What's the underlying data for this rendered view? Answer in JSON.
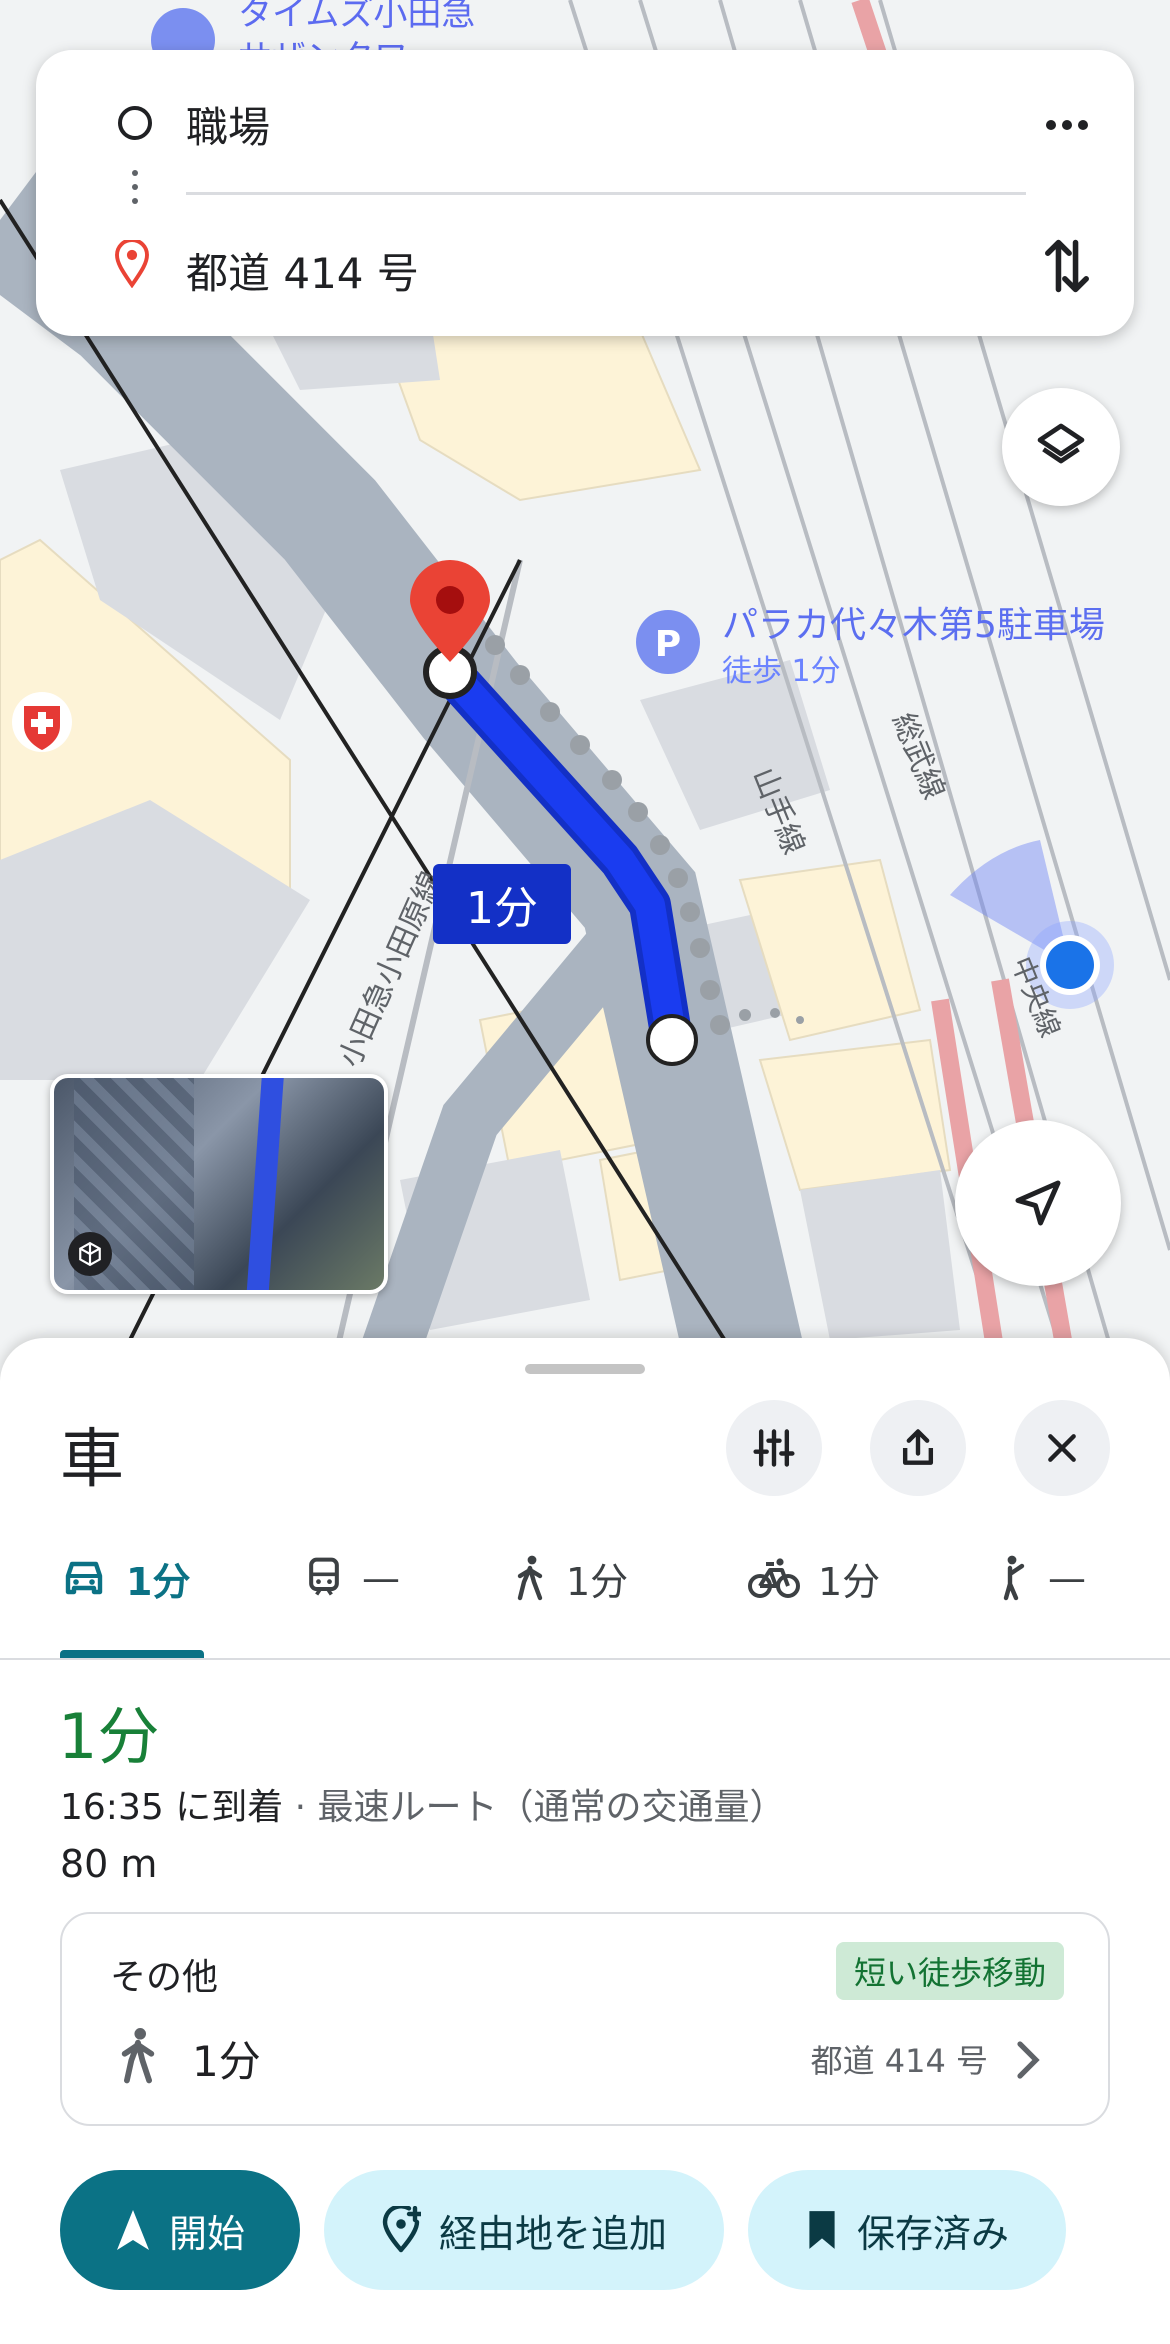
{
  "map": {
    "labels": {
      "top_poi": "タイムズ小田急",
      "top_poi2": "サザンタワー",
      "parking_name": "パラカ代々木第5駐車場",
      "parking_walk": "徒歩 1分",
      "line_yamanote": "山手線",
      "line_sobu": "総武線",
      "line_odakyu": "小田急小田原線",
      "line_chuo": "中央線",
      "route_badge": "1分"
    }
  },
  "route_card": {
    "origin": "職場",
    "destination": "都道 414 号"
  },
  "sheet": {
    "mode_title": "車",
    "tabs": [
      {
        "label": "1分",
        "icon": "car-icon",
        "active": true
      },
      {
        "label": "—",
        "icon": "train-icon",
        "active": false
      },
      {
        "label": "1分",
        "icon": "walk-icon",
        "active": false
      },
      {
        "label": "1分",
        "icon": "bicycle-icon",
        "active": false
      },
      {
        "label": "—",
        "icon": "ride-icon",
        "active": false
      }
    ],
    "duration": "1分",
    "arrival_time": "16:35 に到着",
    "route_desc": " · 最速ルート（通常の交通量）",
    "distance": "80 m",
    "other": {
      "title": "その他",
      "badge": "短い徒歩移動",
      "walk_time": "1分",
      "walk_dest": "都道 414 号"
    },
    "buttons": {
      "start": "開始",
      "add_stop": "経由地を追加",
      "saved": "保存済み"
    }
  },
  "colors": {
    "accent": "#0b7285",
    "route_blue": "#1a3cf0",
    "green_text": "#188038",
    "badge_bg": "#ceead6",
    "chip_bg": "#d3f3fb"
  }
}
